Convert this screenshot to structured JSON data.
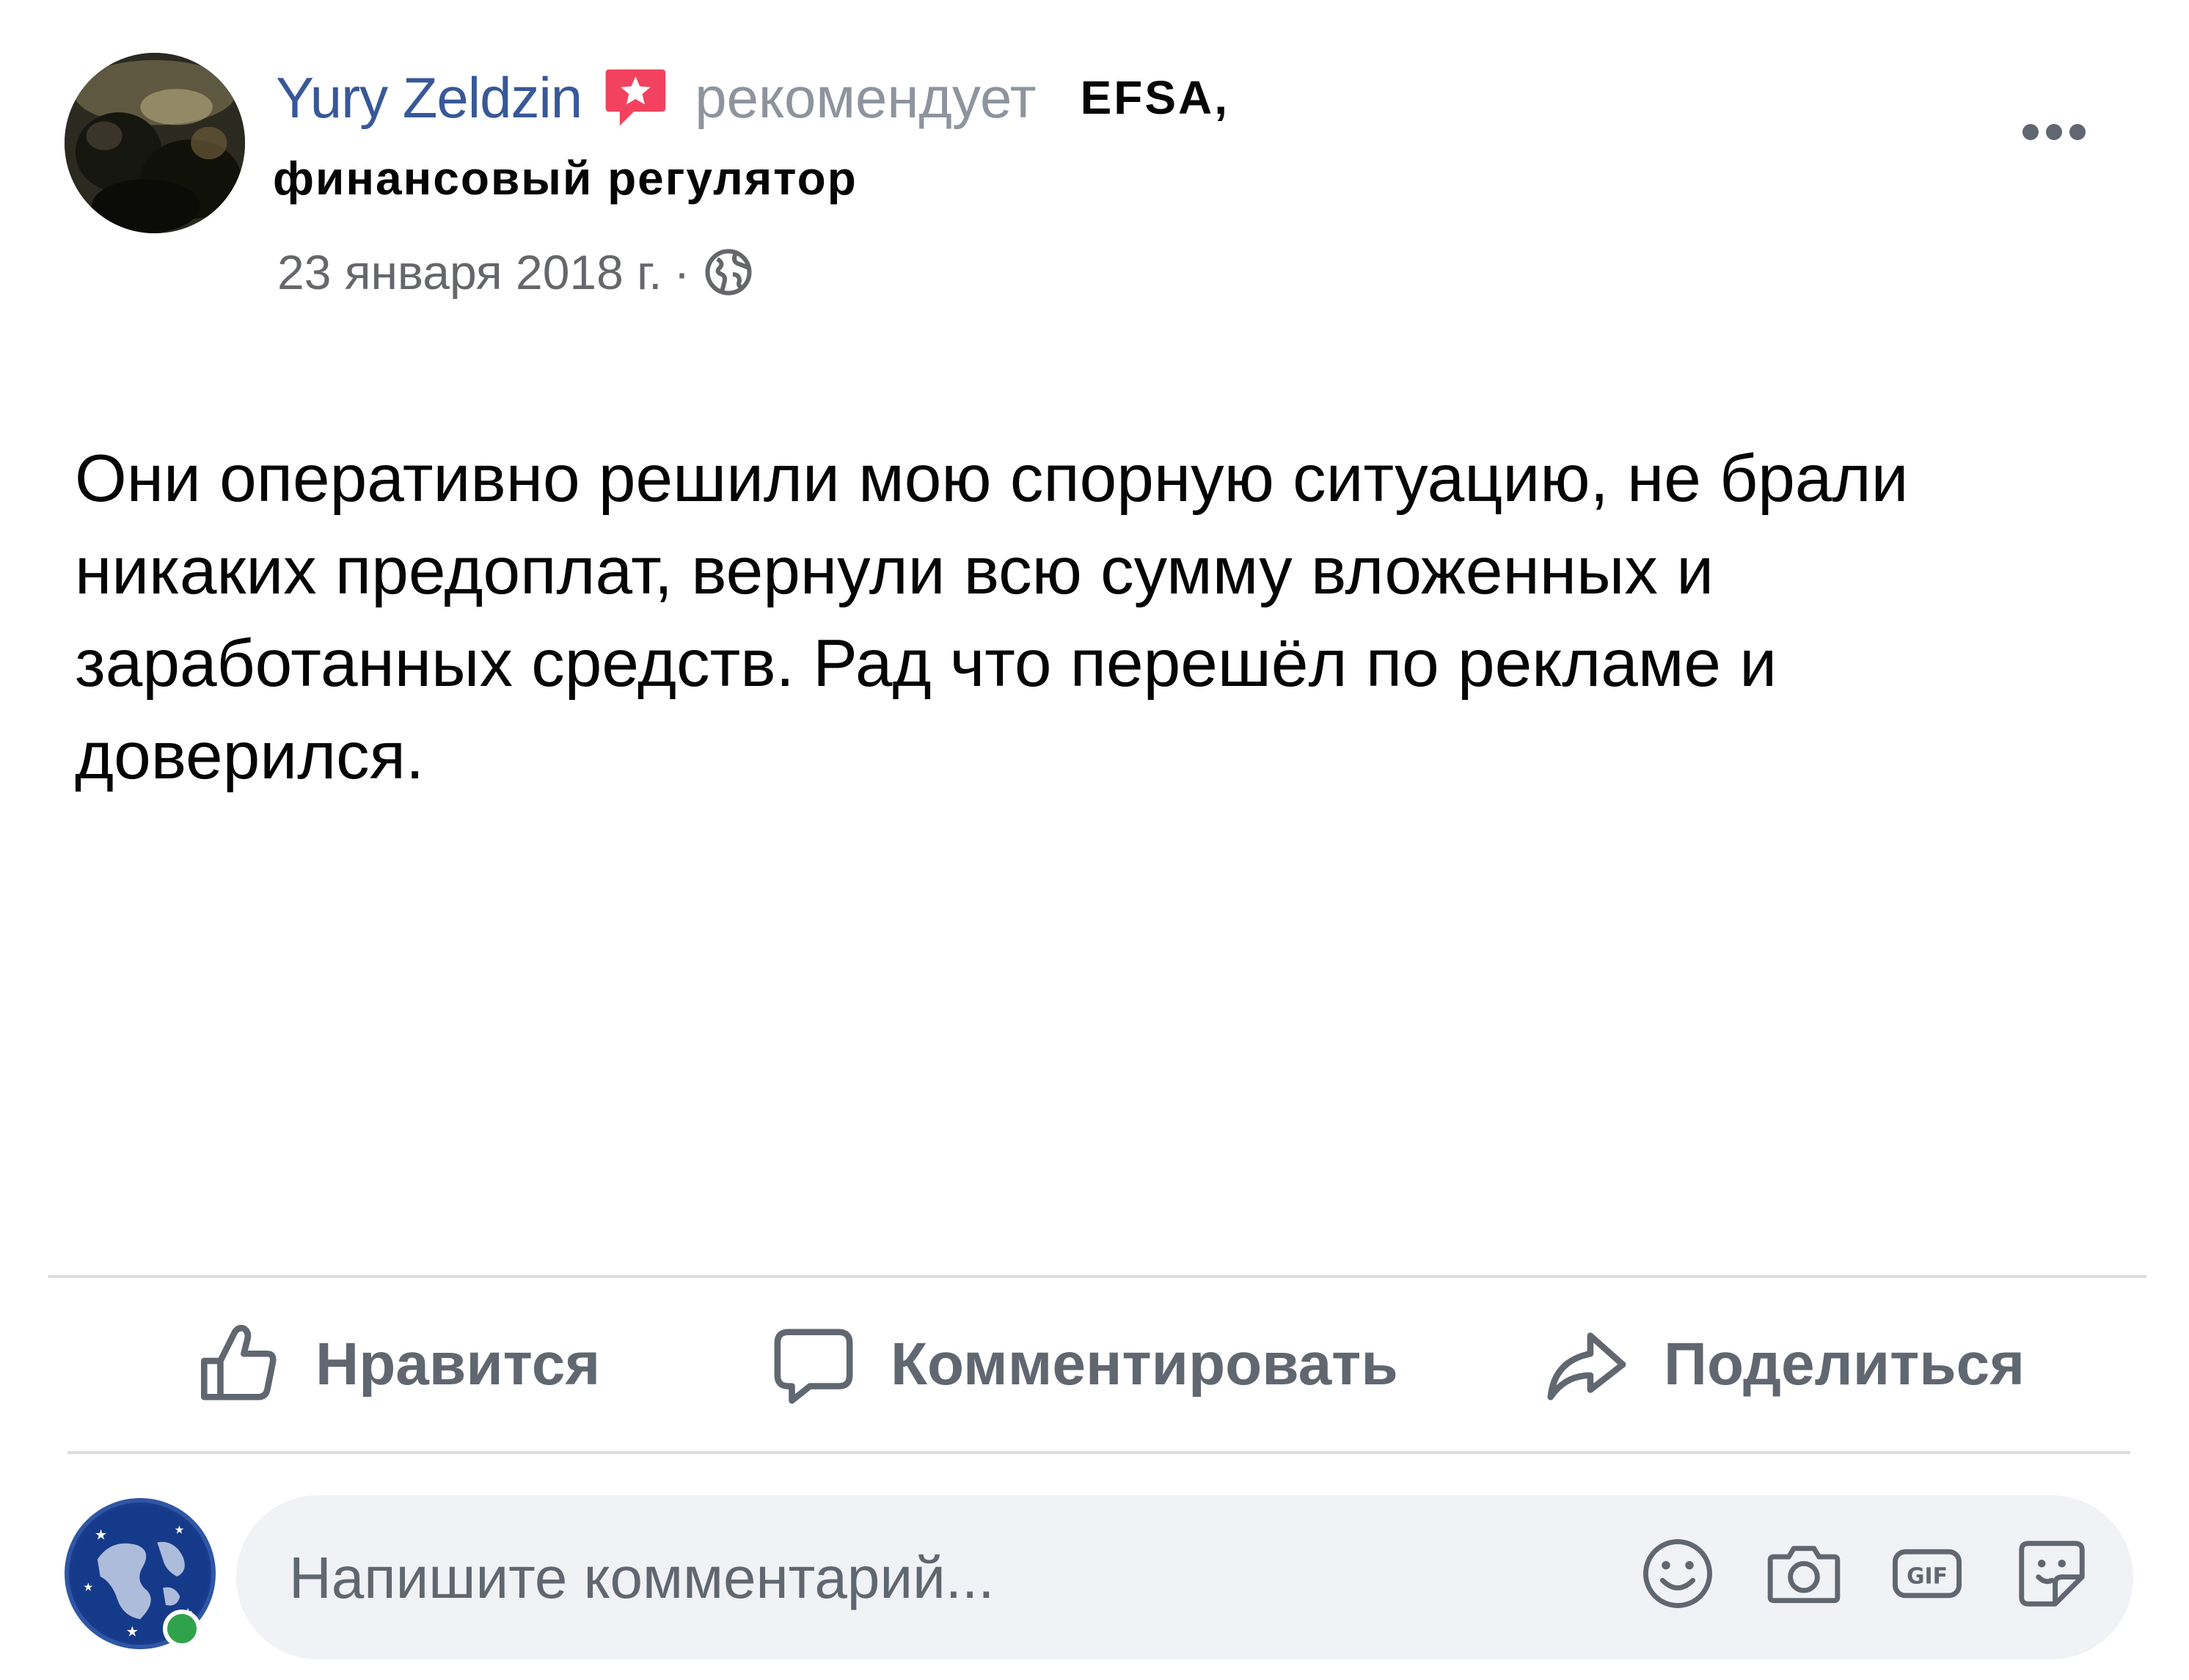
{
  "header": {
    "author_name": "Yury Zeldzin",
    "recommend_verb": "рекомендует",
    "page_name": "EFSA,",
    "page_subtitle": "финансовый регулятор",
    "date": "23 января 2018 г.",
    "separator": "·",
    "privacy_icon": "globe-icon",
    "recommend_icon": "recommendation-star-icon",
    "more_icon": "more-dots-icon"
  },
  "post": {
    "text": "Они оперативно решили мою спорную ситуацию, не брали никаких предоплат, вернули всю сумму вложенных и заработанных средств. Рад что перешёл по рекламе и доверился."
  },
  "actions": {
    "like": {
      "label": "Нравится",
      "icon": "thumbs-up-icon"
    },
    "comment": {
      "label": "Комментировать",
      "icon": "comment-bubble-icon"
    },
    "share": {
      "label": "Поделиться",
      "icon": "share-arrow-icon"
    }
  },
  "composer": {
    "placeholder": "Напишите комментарий...",
    "icons": [
      "emoji-icon",
      "camera-icon",
      "gif-icon",
      "sticker-icon"
    ],
    "online": true
  },
  "colors": {
    "author_link": "#385898",
    "muted_text": "#65676b",
    "action_text": "#606770",
    "recommend_badge": "#f3425f",
    "divider": "#dadde1",
    "composer_bg": "#f0f2f5",
    "online_dot": "#31a24c"
  }
}
